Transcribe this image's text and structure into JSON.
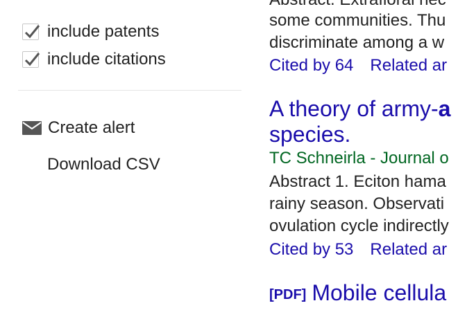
{
  "sidebar": {
    "include_patents": {
      "label": "include patents",
      "checked": true
    },
    "include_citations": {
      "label": "include citations",
      "checked": true
    },
    "create_alert": {
      "label": "Create alert",
      "icon": "envelope-icon"
    },
    "download_csv": {
      "label": "Download CSV"
    }
  },
  "results": [
    {
      "snippet_lines": [
        "Abstract. Extrafloral nec",
        "some communities. Thu",
        "discriminate among a w"
      ],
      "cited_by": "Cited by 64",
      "related": "Related ar"
    },
    {
      "title_line1_prefix": "A theory of army-",
      "title_line1_bold": "a",
      "title_line2": "species.",
      "authors": "TC Schneirla - Journal o",
      "snippet_lines": [
        "Abstract 1. Eciton hama",
        "rainy season. Observati",
        "ovulation cycle indirectly"
      ],
      "cited_by": "Cited by 53",
      "related": "Related ar"
    },
    {
      "format_tag": "[PDF]",
      "title_line1": "Mobile cellula"
    }
  ],
  "colors": {
    "link": "#1a0dab",
    "author": "#006621",
    "text": "#222222"
  }
}
